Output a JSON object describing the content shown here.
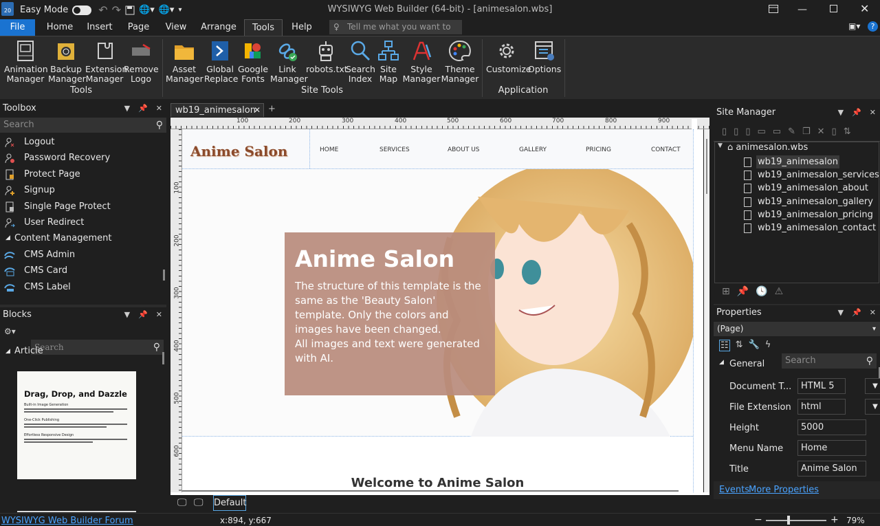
{
  "app": {
    "title": "WYSIWYG Web Builder (64-bit) - [animesalon.wbs]",
    "easy_mode_label": "Easy Mode"
  },
  "menu": {
    "tabs": [
      "File",
      "Home",
      "Insert",
      "Page",
      "View",
      "Arrange",
      "Tools",
      "Help"
    ],
    "active_tab": "Tools",
    "tell_me_placeholder": "Tell me what you want to d..."
  },
  "ribbon": {
    "groups": [
      {
        "label": "Tools",
        "buttons": [
          {
            "line1": "Animation",
            "line2": "Manager",
            "icon": "animation-manager-icon"
          },
          {
            "line1": "Backup",
            "line2": "Manager",
            "icon": "backup-manager-icon"
          },
          {
            "line1": "Extension",
            "line2": "Manager",
            "icon": "extension-manager-icon"
          },
          {
            "line1": "Remove",
            "line2": "Logo",
            "icon": "remove-logo-icon"
          }
        ]
      },
      {
        "label": "Site Tools",
        "buttons": [
          {
            "line1": "Asset",
            "line2": "Manager",
            "icon": "asset-manager-icon"
          },
          {
            "line1": "Global",
            "line2": "Replace",
            "icon": "global-replace-icon"
          },
          {
            "line1": "Google",
            "line2": "Fonts",
            "icon": "google-fonts-icon"
          },
          {
            "line1": "Link",
            "line2": "Manager",
            "icon": "link-manager-icon"
          },
          {
            "line1": "robots.txt",
            "line2": "",
            "icon": "robots-icon"
          },
          {
            "line1": "Search",
            "line2": "Index",
            "icon": "search-index-icon"
          },
          {
            "line1": "Site",
            "line2": "Map",
            "icon": "site-map-icon"
          },
          {
            "line1": "Style",
            "line2": "Manager",
            "icon": "style-manager-icon"
          },
          {
            "line1": "Theme",
            "line2": "Manager",
            "icon": "theme-manager-icon"
          }
        ]
      },
      {
        "label": "Application",
        "buttons": [
          {
            "line1": "Customize",
            "line2": "",
            "icon": "customize-icon"
          },
          {
            "line1": "Options",
            "line2": "",
            "icon": "options-icon"
          }
        ]
      }
    ]
  },
  "toolbox": {
    "title": "Toolbox",
    "search_placeholder": "Search",
    "items": [
      "Logout",
      "Password Recovery",
      "Protect Page",
      "Signup",
      "Single Page Protect",
      "User Redirect"
    ],
    "section": "Content Management",
    "section_items": [
      "CMS Admin",
      "CMS Card",
      "CMS Label"
    ]
  },
  "blocks": {
    "title": "Blocks",
    "search_placeholder": "Search",
    "category": "Article",
    "preview": {
      "heading": "Drag, Drop, and Dazzle",
      "sub1": "Built-in Image Generation",
      "sub2": "One-Click Publishing",
      "sub3": "Effortless Responsive Design"
    }
  },
  "document": {
    "tab_label": "wb19_animesalon",
    "ruler_h": [
      "100",
      "200",
      "300",
      "400",
      "500",
      "600",
      "700",
      "800",
      "900"
    ],
    "ruler_v": [
      "100",
      "200",
      "300",
      "400",
      "500",
      "600"
    ],
    "site": {
      "logo": "Anime Salon",
      "nav": [
        "HOME",
        "SERVICES",
        "ABOUT US",
        "GALLERY",
        "PRICING",
        "CONTACT"
      ],
      "hero_title": "Anime Salon",
      "hero_text": "The structure of this template is the same as the 'Beauty Salon' template. Only the colors and images have been changed.",
      "hero_text2": "All images and text were generated with AI.",
      "welcome": "Welcome to Anime Salon"
    }
  },
  "site_manager": {
    "title": "Site Manager",
    "root": "animesalon.wbs",
    "pages": [
      "wb19_animesalon",
      "wb19_animesalon_services",
      "wb19_animesalon_about",
      "wb19_animesalon_gallery",
      "wb19_animesalon_pricing",
      "wb19_animesalon_contact"
    ]
  },
  "properties": {
    "title": "Properties",
    "object": "(Page)",
    "search_placeholder": "Search",
    "section": "General",
    "rows": [
      {
        "label": "Document T...",
        "value": "HTML 5"
      },
      {
        "label": "File Extension",
        "value": "html"
      },
      {
        "label": "Height",
        "value": "5000"
      },
      {
        "label": "Menu Name",
        "value": "Home"
      },
      {
        "label": "Title",
        "value": "Anime Salon"
      }
    ],
    "events_link": "Events",
    "more_link": "More Properties"
  },
  "statusbar": {
    "forum_link": "WYSIWYG Web Builder Forum",
    "coords": "x:894, y:667",
    "zoom": "79%",
    "breakpoint": "Default"
  }
}
